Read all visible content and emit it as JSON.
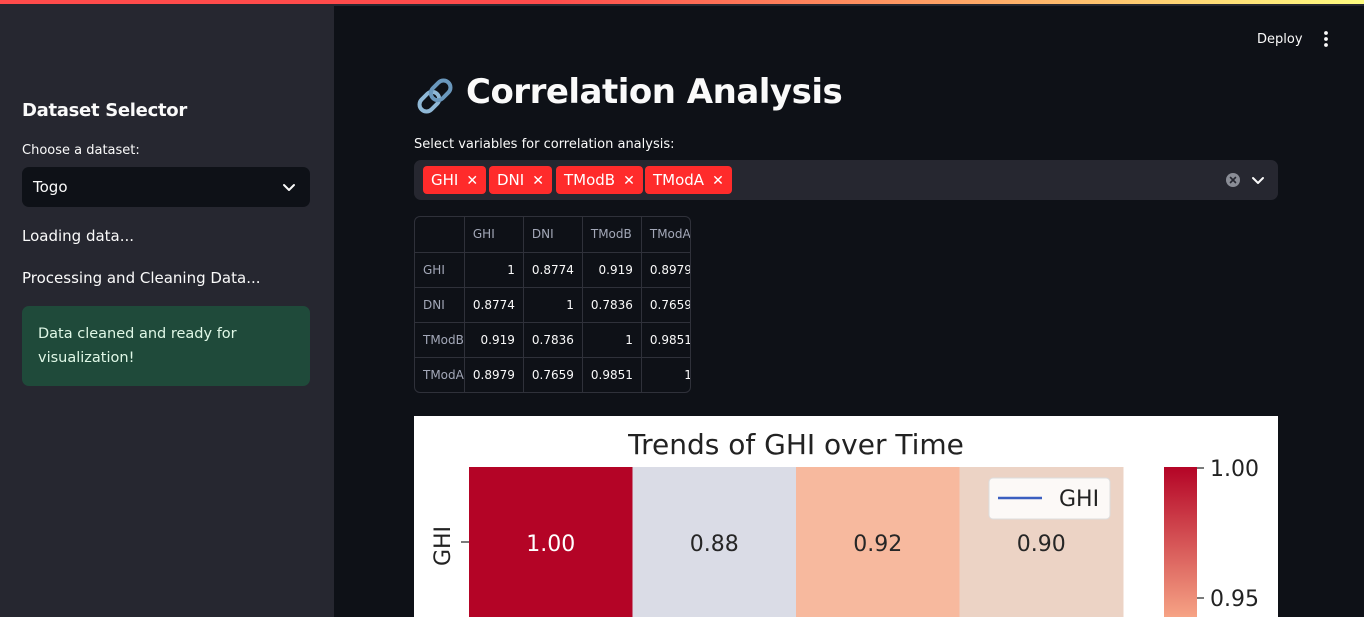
{
  "sidebar": {
    "title": "Dataset Selector",
    "select_label": "Choose a dataset:",
    "select_value": "Togo",
    "status_loading": "Loading data...",
    "status_processing": "Processing and Cleaning Data...",
    "success_message": "Data cleaned and ready for visualization!"
  },
  "header": {
    "deploy_label": "Deploy",
    "menu_icon": "kebab-icon"
  },
  "main": {
    "title": "Correlation Analysis",
    "title_icon": "link-icon",
    "multiselect_label": "Select variables for correlation analysis:",
    "selected_chips": [
      "GHI",
      "DNI",
      "TModB",
      "TModA"
    ],
    "chip_color": "#ff2b2b"
  },
  "table": {
    "columns": [
      "",
      "GHI",
      "DNI",
      "TModB",
      "TModA"
    ],
    "rows": [
      {
        "label": "GHI",
        "values": [
          "1",
          "0.8774",
          "0.919",
          "0.8979"
        ]
      },
      {
        "label": "DNI",
        "values": [
          "0.8774",
          "1",
          "0.7836",
          "0.7659"
        ]
      },
      {
        "label": "TModB",
        "values": [
          "0.919",
          "0.7836",
          "1",
          "0.9851"
        ]
      },
      {
        "label": "TModA",
        "values": [
          "0.8979",
          "0.7659",
          "0.9851",
          "1"
        ]
      }
    ]
  },
  "chart_data": {
    "type": "heatmap",
    "title": "Trends of GHI over Time",
    "ylabel": "GHI",
    "row_labels": [
      "GHI"
    ],
    "values": [
      [
        1.0,
        0.88,
        0.92,
        0.9
      ]
    ],
    "cell_labels": [
      "1.00",
      "0.88",
      "0.92",
      "0.90"
    ],
    "cell_colors": [
      "#b40426",
      "#dadce6",
      "#f7b99e",
      "#ecd3c5"
    ],
    "legend": {
      "entries": [
        "GHI"
      ],
      "placement": "upper right",
      "line_color": "#3b5fc0"
    },
    "colorbar": {
      "ticks": [
        "1.00",
        "0.95"
      ],
      "colors": [
        "#b40426",
        "#f6a385"
      ]
    }
  },
  "colors": {
    "background": "#0e1117",
    "sidebar": "#262730",
    "success_bg": "#1f4a3a",
    "accent": "#ff4b4b"
  }
}
